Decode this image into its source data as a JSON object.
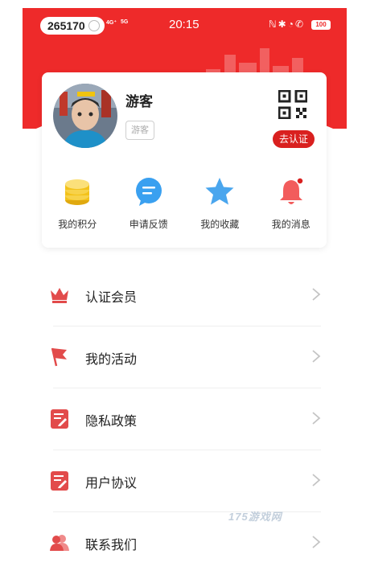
{
  "status": {
    "pill_number": "265170",
    "time": "20:15",
    "signal_a": "4G⁺",
    "signal_b": "5G",
    "battery": "100"
  },
  "profile": {
    "name": "游客",
    "tag": "游客",
    "certify_button": "去认证"
  },
  "quick": [
    {
      "label": "我的积分",
      "icon": "coins-icon"
    },
    {
      "label": "申请反馈",
      "icon": "chat-bubble-icon"
    },
    {
      "label": "我的收藏",
      "icon": "star-icon"
    },
    {
      "label": "我的消息",
      "icon": "bell-icon"
    }
  ],
  "menu": [
    {
      "label": "认证会员",
      "icon": "crown-icon"
    },
    {
      "label": "我的活动",
      "icon": "flag-icon"
    },
    {
      "label": "隐私政策",
      "icon": "document-icon"
    },
    {
      "label": "用户协议",
      "icon": "document-icon"
    },
    {
      "label": "联系我们",
      "icon": "people-icon"
    }
  ],
  "watermark": "175游戏网",
  "colors": {
    "accent": "#ee2a2a",
    "button": "#d9201f",
    "gold": "#f3c21a",
    "blue": "#3aa0f0"
  }
}
